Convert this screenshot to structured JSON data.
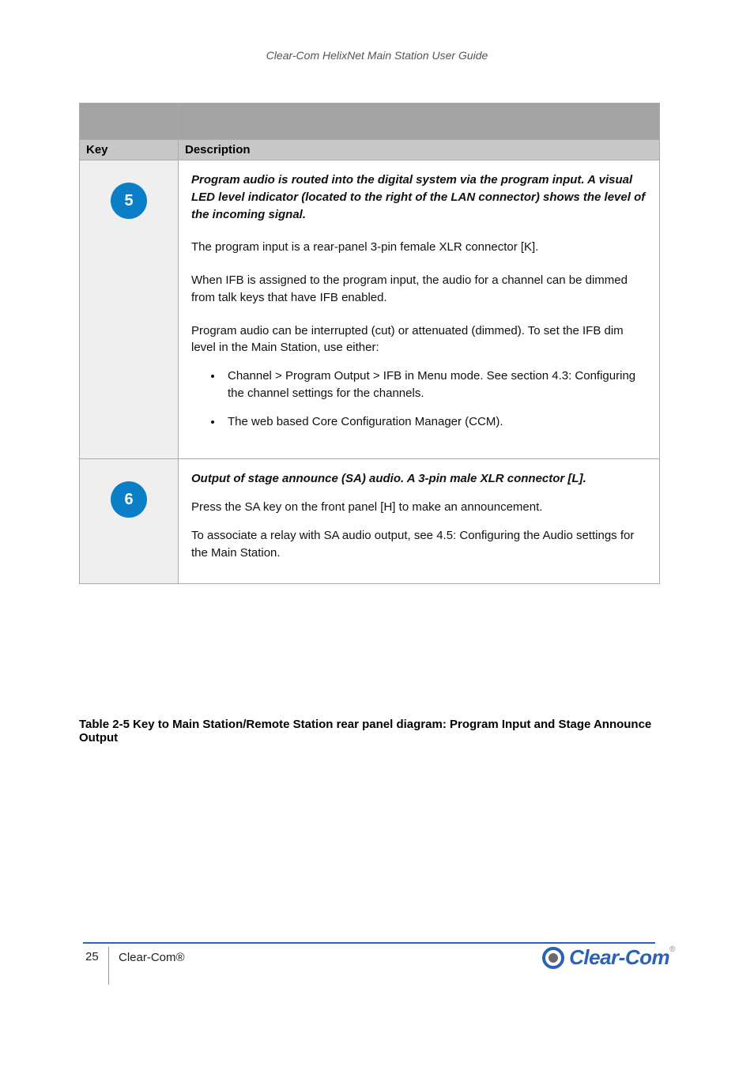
{
  "doc_title": "Clear-Com HelixNet Main Station User Guide",
  "table": {
    "head": {
      "col1": "Key",
      "col2": "Description"
    },
    "rows": [
      {
        "circle": "5",
        "p1": "Program audio is routed into the digital system via the program input. A visual LED level indicator (located to the right of the LAN connector) shows the level of the incoming signal.",
        "p2": "The program input is a rear-panel 3-pin female XLR connector [K].",
        "p3": "When IFB is assigned to the program input, the audio for a channel can be dimmed from talk keys that have IFB enabled.",
        "p4": "Program audio can be interrupted (cut) or attenuated (dimmed). To set the IFB dim level in the Main Station, use either:",
        "bullets": [
          "Channel > Program Output > IFB in Menu mode. See section 4.3: Configuring the channel settings for the channels.",
          "The web based Core Configuration Manager (CCM)."
        ]
      },
      {
        "circle": "6",
        "p1": "Output of stage announce (SA) audio. A 3-pin male XLR connector [L].",
        "p2": "Press the SA key on the front panel [H] to make an announcement.",
        "p3": "To associate a relay with SA audio output, see 4.5: Configuring the Audio settings for the Main Station.",
        "p4": ""
      }
    ]
  },
  "caption": "Table 2-5 Key to Main Station/Remote Station rear panel diagram: Program Input and Stage Announce Output",
  "page_number": "25",
  "footer_text": "Clear-Com®",
  "logo_text": "Clear-Com",
  "logo_tm": "®"
}
